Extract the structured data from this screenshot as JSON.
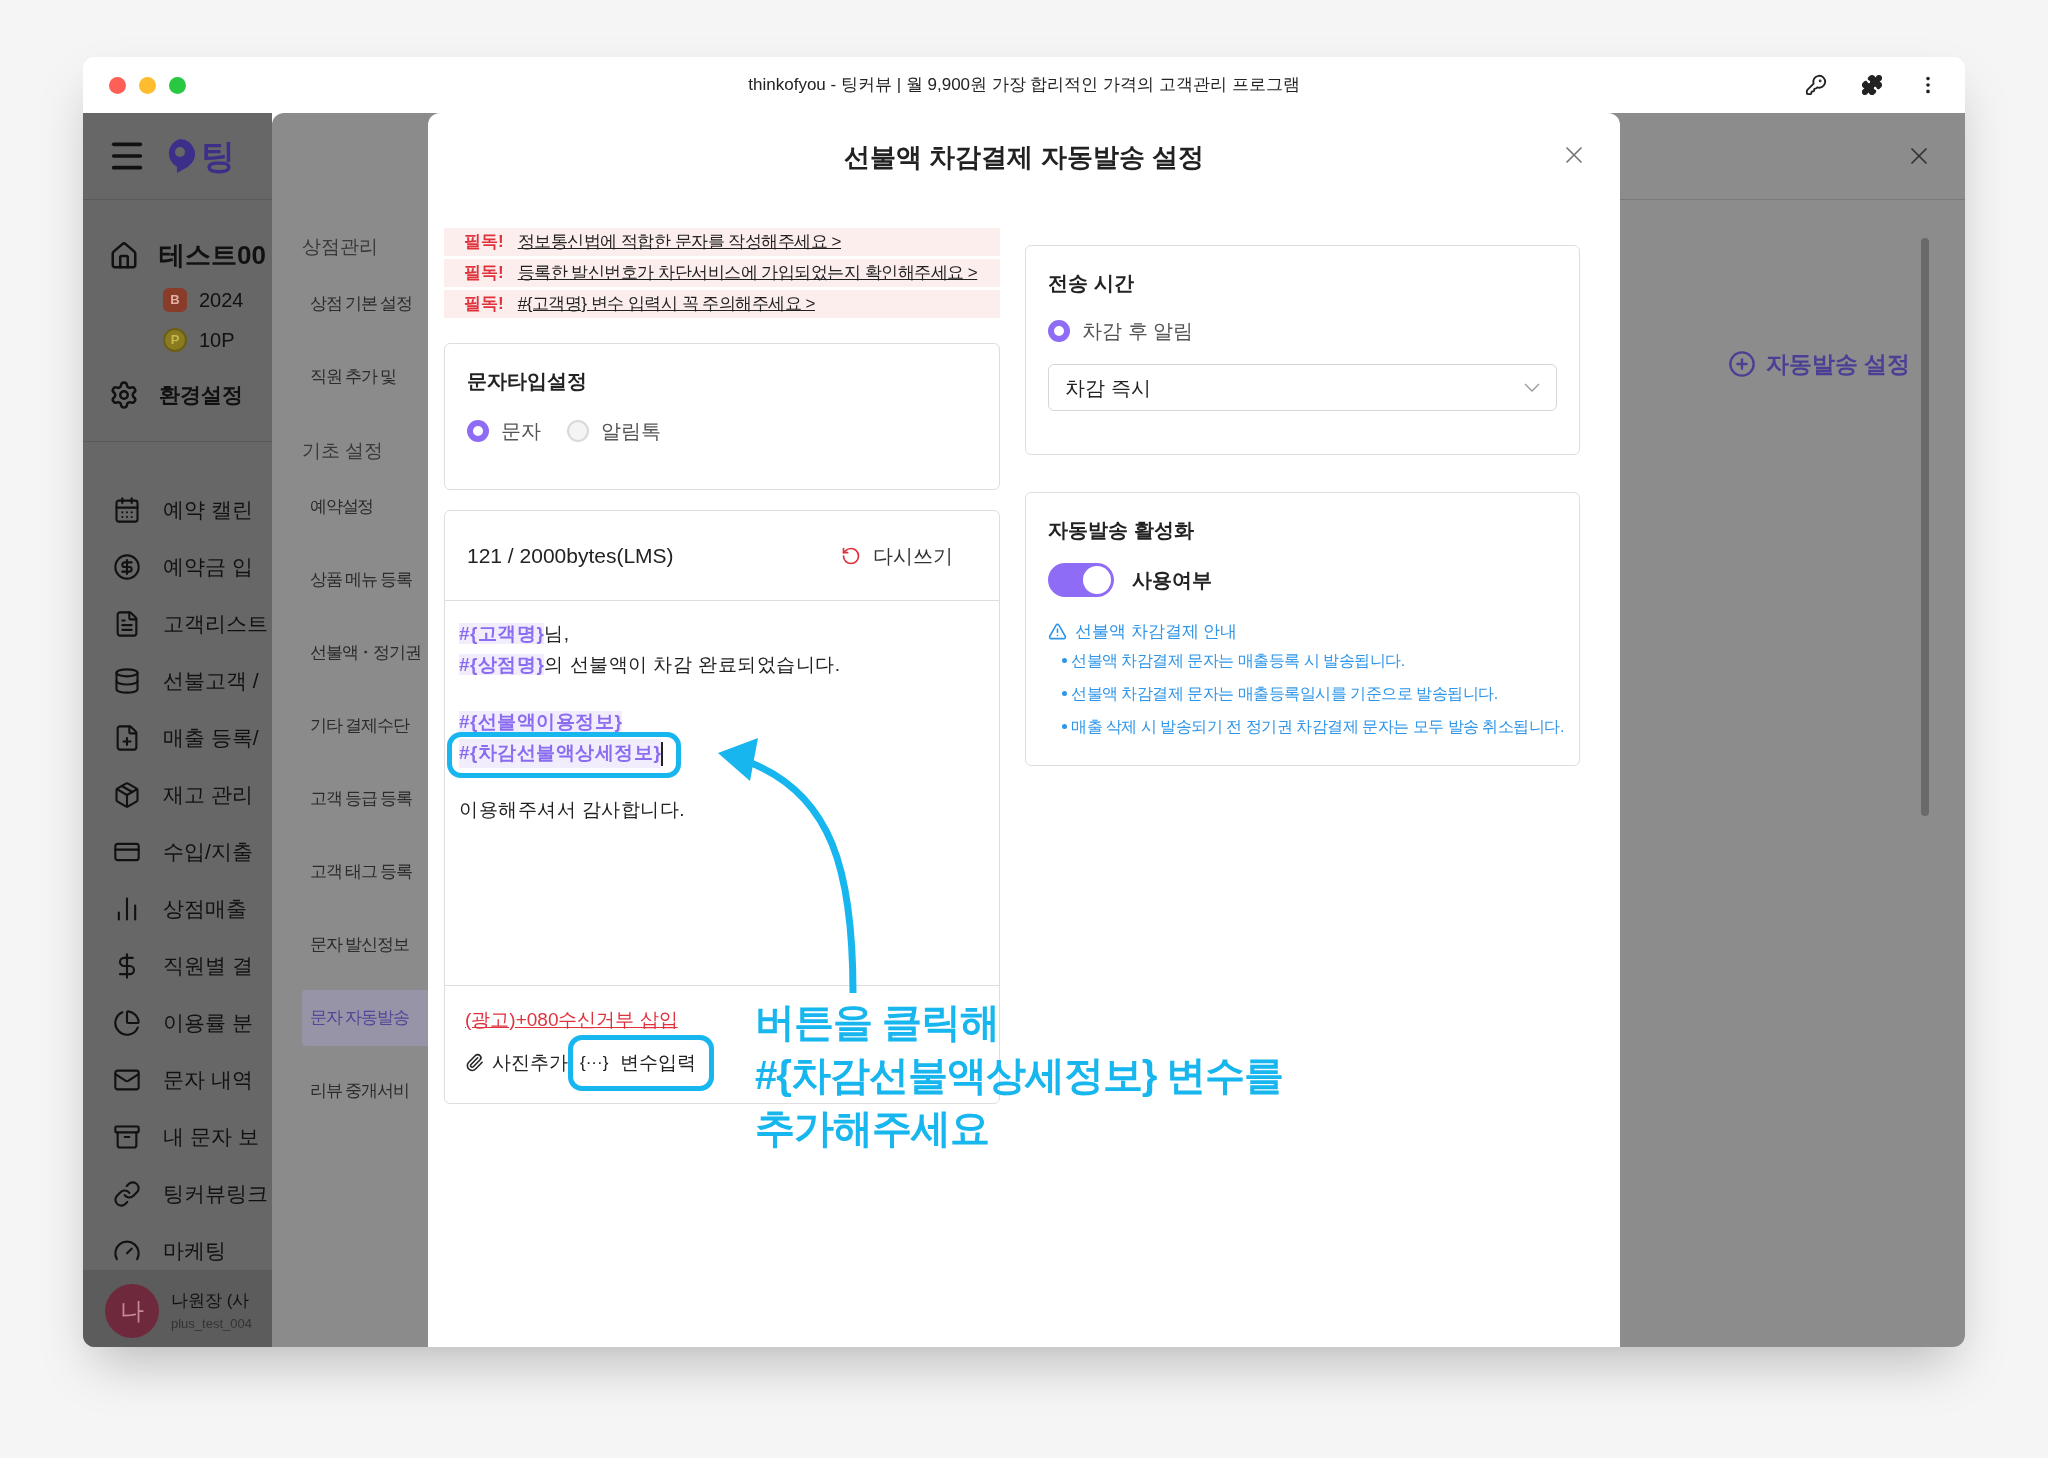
{
  "browser": {
    "title": "thinkofyou - 팅커뷰 | 월 9,900원 가장 합리적인 가격의 고객관리 프로그램"
  },
  "sidebar": {
    "logo": "팅",
    "store": {
      "name": "테스트00",
      "badges": [
        {
          "kind": "grade",
          "mark": "B",
          "text": "2024"
        },
        {
          "kind": "point",
          "mark": "P",
          "text": "10P"
        }
      ]
    },
    "settings": "환경설정",
    "items": [
      {
        "label": "예약 캘린"
      },
      {
        "label": "예약금 입"
      },
      {
        "label": "고객리스트"
      },
      {
        "label": "선불고객 /"
      },
      {
        "label": "매출 등록/"
      },
      {
        "label": "재고 관리"
      },
      {
        "label": "수입/지출"
      },
      {
        "label": "상점매출"
      },
      {
        "label": "직원별 결"
      },
      {
        "label": "이용률 분"
      },
      {
        "label": "문자 내역"
      },
      {
        "label": "내 문자 보"
      },
      {
        "label": "팅커뷰링크"
      },
      {
        "label": "마케팅"
      }
    ],
    "user": {
      "avatar": "나",
      "name": "나원장 (사",
      "id": "plus_test_004"
    }
  },
  "submenu": {
    "sections": [
      {
        "title": "상점관리",
        "items": [
          {
            "label": "상점 기본 설정",
            "selected": false
          },
          {
            "label": "직원 추가 및",
            "selected": false
          }
        ]
      },
      {
        "title": "기초 설정",
        "items": [
          {
            "label": "예약설정",
            "selected": false
          },
          {
            "label": "상품 메뉴 등록",
            "selected": false
          },
          {
            "label": "선불액・정기권",
            "selected": false
          },
          {
            "label": "기타 결제수단",
            "selected": false
          },
          {
            "label": "고객 등급 등록",
            "selected": false
          },
          {
            "label": "고객 태그 등록",
            "selected": false
          },
          {
            "label": "문자 발신정보",
            "selected": false
          },
          {
            "label": "문자 자동발송",
            "selected": true
          },
          {
            "label": "리뷰 중개서비",
            "selected": false
          }
        ]
      }
    ]
  },
  "background": {
    "add_button": "자동발송 설정"
  },
  "modal": {
    "title": "선불액 차감결제 자동발송 설정",
    "notices": [
      {
        "tag": "필독!",
        "text": "정보통신법에 적합한 문자를 작성해주세요 >"
      },
      {
        "tag": "필독!",
        "text": "등록한 발신번호가 차단서비스에 가입되었는지 확인해주세요 >"
      },
      {
        "tag": "필독!",
        "text": "#{고객명} 변수 입력시 꼭 주의해주세요 >"
      }
    ],
    "message_type": {
      "title": "문자타입설정",
      "options": [
        {
          "label": "문자",
          "selected": true
        },
        {
          "label": "알림톡",
          "selected": false
        }
      ]
    },
    "editor": {
      "counter": "121 / 2000bytes(LMS)",
      "reset": "다시쓰기",
      "paragraphs": [
        [
          [
            {
              "kind": "variable",
              "text": "#{고객명}"
            },
            {
              "kind": "text",
              "text": "님,"
            }
          ],
          [
            {
              "kind": "variable",
              "text": "#{상점명}"
            },
            {
              "kind": "text",
              "text": "의 선불액이 차감 완료되었습니다."
            }
          ]
        ],
        [
          [
            {
              "kind": "variable",
              "text": "#{선불액이용정보}"
            }
          ],
          [
            {
              "kind": "variable",
              "text": "#{차감선불액상세정보}",
              "highlighted": true
            }
          ]
        ],
        [
          [
            {
              "kind": "text",
              "text": "이용해주셔서 감사합니다."
            }
          ]
        ]
      ],
      "ad_link": "(광고)+080수신거부 삽입",
      "photo_button": "사진추가",
      "variable_icon": "{···}",
      "variable_button": "변수입력",
      "variable_button_highlighted": true
    },
    "send_time": {
      "title": "전송 시간",
      "option": {
        "label": "차감 후 알림",
        "selected": true
      },
      "select_value": "차감 즉시"
    },
    "auto_send": {
      "title": "자동발송 활성화",
      "toggle": {
        "label": "사용여부",
        "on": true
      },
      "info_title": "선불액 차감결제 안내",
      "info_items": [
        "선불액 차감결제 문자는 매출등록 시 발송됩니다.",
        "선불액 차감결제 문자는 매출등록일시를 기준으로 발송됩니다.",
        "매출 삭제 시 발송되기 전 정기권 차감결제 문자는 모두 발송 취소됩니다."
      ]
    }
  },
  "annotation": {
    "lines": [
      "버튼을 클릭해",
      "#{차감선불액상세정보} 변수를",
      "추가해주세요"
    ]
  }
}
